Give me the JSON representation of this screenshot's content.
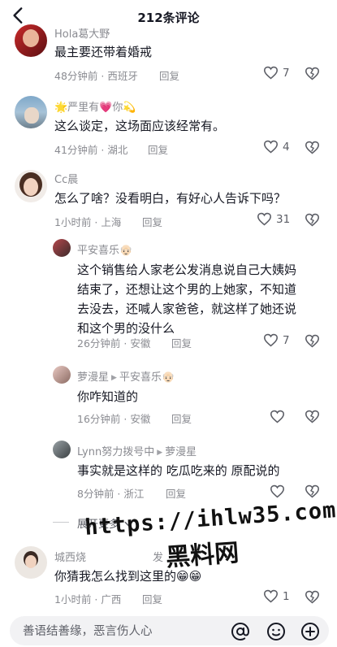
{
  "header": {
    "title": "212条评论"
  },
  "comments": [
    {
      "name": "Hola葛大野",
      "text": "最主要还带着婚戒",
      "time": "48分钟前",
      "location": "西班牙",
      "reply": "回复",
      "likes": "7"
    },
    {
      "name": "🌟严里有💗你💫",
      "text": "这么谈定，这场面应该经常有。",
      "time": "41分钟前",
      "location": "湖北",
      "reply": "回复",
      "likes": "4"
    },
    {
      "name": "Cc晨",
      "text": "怎么了啥？没看明白，有好心人告诉下吗？",
      "time": "1小时前",
      "location": "上海",
      "reply": "回复",
      "likes": "31"
    }
  ],
  "replies": [
    {
      "name": "平安喜乐👴🏻",
      "text_lines": [
        "这个销售给人家老公发消息说自己大姨妈",
        "结束了，还想让这个男的上她家，不知道",
        "去没去，还喊人家爸爸，就这样了她还说",
        "和这个男的没什么"
      ],
      "time": "26分钟前",
      "location": "安徽",
      "reply": "回复",
      "likes": "7"
    },
    {
      "name": "萝漫星",
      "reply_to": "平安喜乐👴🏻",
      "text": "你咋知道的",
      "time": "16分钟前",
      "location": "安徽",
      "reply": "回复"
    },
    {
      "name": "Lynn努力拨号中",
      "reply_to": "萝漫星",
      "text": "事实就是这样的 吃瓜吃来的 原配说的",
      "time": "8分钟前",
      "location": "浙江",
      "reply": "回复"
    }
  ],
  "expand_label": "展开更多",
  "last_comment": {
    "name": "城西烧",
    "name_tail": "发",
    "text": "你猜我怎么找到这里的😁😁",
    "time": "1小时前",
    "location": "广西",
    "reply": "回复",
    "likes": "1"
  },
  "watermark": {
    "line1": "https://ihlw35.com",
    "line2": "黑料网"
  },
  "input": {
    "placeholder": "善语结善缘，恶言伤人心"
  },
  "icons": [
    "back-arrow-icon",
    "heart-icon",
    "dislike-heart-icon",
    "at-icon",
    "emoji-icon",
    "plus-icon",
    "chevron-down-icon"
  ]
}
